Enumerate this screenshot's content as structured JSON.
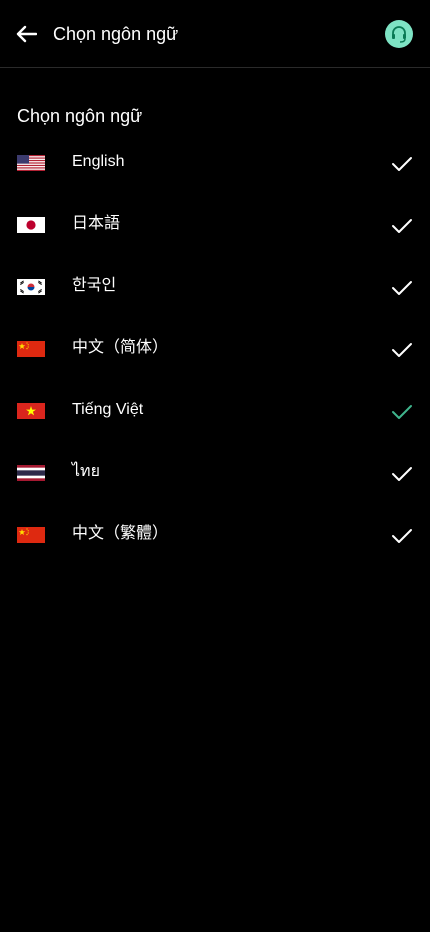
{
  "header": {
    "title": "Chọn ngôn ngữ",
    "back_icon": "arrow-left-icon",
    "support_icon": "headset-icon"
  },
  "section": {
    "title": "Chọn ngôn ngữ"
  },
  "languages": [
    {
      "label": "English",
      "flag": "us-flag-icon",
      "selected": false
    },
    {
      "label": "日本語",
      "flag": "japan-flag-icon",
      "selected": false
    },
    {
      "label": "한국인",
      "flag": "korea-flag-icon",
      "selected": false
    },
    {
      "label": "中文（简体）",
      "flag": "china-flag-icon",
      "selected": false
    },
    {
      "label": "Tiếng Việt",
      "flag": "vietnam-flag-icon",
      "selected": true
    },
    {
      "label": "ไทย",
      "flag": "thailand-flag-icon",
      "selected": false
    },
    {
      "label": "中文（繁體）",
      "flag": "china-flag-icon",
      "selected": false
    }
  ],
  "colors": {
    "background": "#000000",
    "text": "#ffffff",
    "check_default": "#ffffff",
    "check_selected": "#3fb58d",
    "support_accent": "#7ee3c4"
  }
}
